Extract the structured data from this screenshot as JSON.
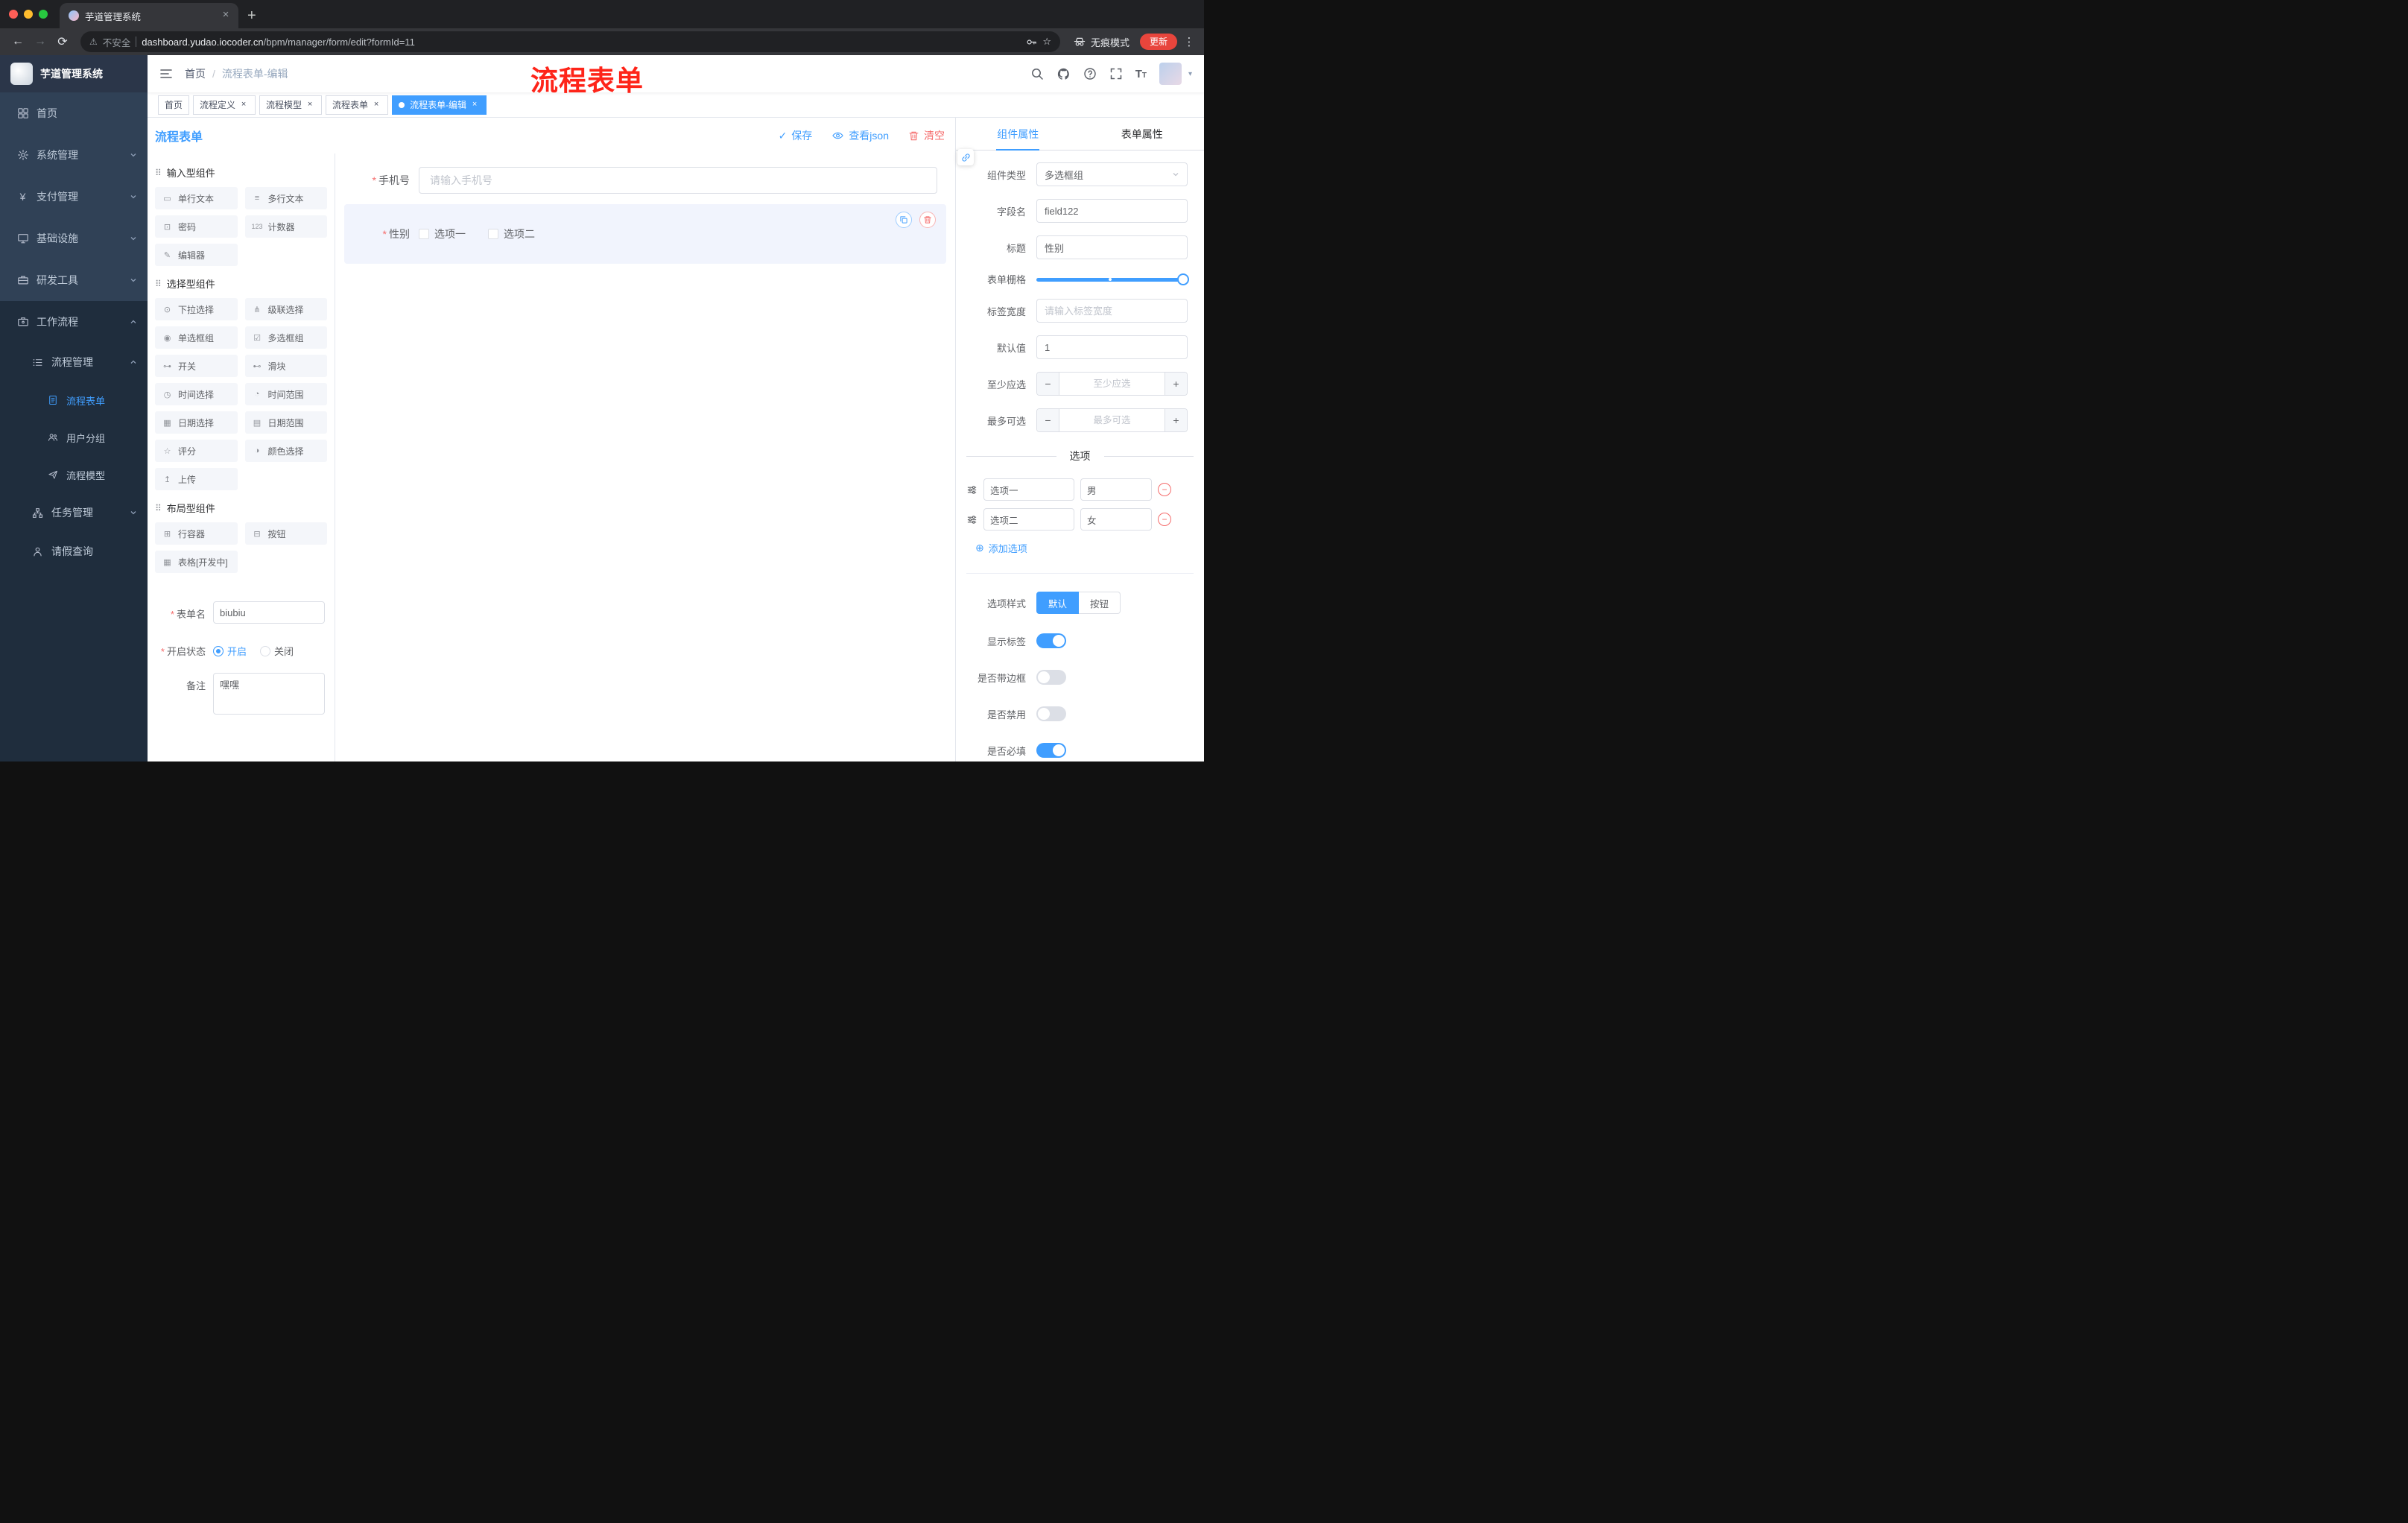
{
  "annotation": {
    "text": "流程表单"
  },
  "colors": {
    "accent": "#409eff",
    "danger": "#f56c6c",
    "annotation_red": "#fe2419",
    "active_tag": "#409eff"
  },
  "browser": {
    "tab_title": "芋道管理系统",
    "security_label": "不安全",
    "url_host": "dashboard.yudao.iocoder.cn",
    "url_path": "/bpm/manager/form/edit?formId=11",
    "incognito_label": "无痕模式",
    "update_label": "更新"
  },
  "sidebar": {
    "logo_title": "芋道管理系统",
    "items": [
      {
        "label": "首页"
      },
      {
        "label": "系统管理"
      },
      {
        "label": "支付管理"
      },
      {
        "label": "基础设施"
      },
      {
        "label": "研发工具"
      },
      {
        "label": "工作流程"
      },
      {
        "label": "流程管理"
      },
      {
        "label": "流程表单"
      },
      {
        "label": "用户分组"
      },
      {
        "label": "流程模型"
      },
      {
        "label": "任务管理"
      },
      {
        "label": "请假查询"
      }
    ]
  },
  "header": {
    "breadcrumb_home": "首页",
    "breadcrumb_current": "流程表单-编辑"
  },
  "tags": [
    {
      "label": "首页"
    },
    {
      "label": "流程定义"
    },
    {
      "label": "流程模型"
    },
    {
      "label": "流程表单"
    },
    {
      "label": "流程表单-编辑"
    }
  ],
  "designer": {
    "title": "流程表单",
    "save": "保存",
    "view_json": "查看json",
    "clear": "清空"
  },
  "palette": {
    "groups": [
      {
        "title": "输入型组件",
        "items": [
          {
            "label": "单行文本",
            "icon": "▭"
          },
          {
            "label": "多行文本",
            "icon": "≡"
          },
          {
            "label": "密码",
            "icon": "⊡"
          },
          {
            "label": "计数器",
            "icon": "123"
          },
          {
            "label": "编辑器",
            "icon": "✎"
          }
        ]
      },
      {
        "title": "选择型组件",
        "items": [
          {
            "label": "下拉选择",
            "icon": "⊙"
          },
          {
            "label": "级联选择",
            "icon": "⋔"
          },
          {
            "label": "单选框组",
            "icon": "◉"
          },
          {
            "label": "多选框组",
            "icon": "☑"
          },
          {
            "label": "开关",
            "icon": "⊶"
          },
          {
            "label": "滑块",
            "icon": "⊷"
          },
          {
            "label": "时间选择",
            "icon": "◷"
          },
          {
            "label": "时间范围",
            "icon": "◔"
          },
          {
            "label": "日期选择",
            "icon": "▦"
          },
          {
            "label": "日期范围",
            "icon": "▤"
          },
          {
            "label": "评分",
            "icon": "☆"
          },
          {
            "label": "颜色选择",
            "icon": "◑"
          },
          {
            "label": "上传",
            "icon": "↥"
          }
        ]
      },
      {
        "title": "布局型组件",
        "items": [
          {
            "label": "行容器",
            "icon": "⊞"
          },
          {
            "label": "按钮",
            "icon": "⊟"
          },
          {
            "label": "表格[开发中]",
            "icon": "▦"
          }
        ]
      }
    ],
    "form": {
      "name_label": "表单名",
      "name_value": "biubiu",
      "status_label": "开启状态",
      "status_on": "开启",
      "status_off": "关闭",
      "remark_label": "备注",
      "remark_value": "嘿嘿"
    }
  },
  "canvas": {
    "phone_label": "手机号",
    "phone_placeholder": "请输入手机号",
    "gender_label": "性别",
    "gender_opt1": "选项一",
    "gender_opt2": "选项二"
  },
  "props": {
    "tab_component": "组件属性",
    "tab_form": "表单属性",
    "component_type_label": "组件类型",
    "component_type_value": "多选框组",
    "field_label": "字段名",
    "field_value": "field122",
    "title_label": "标题",
    "title_value": "性别",
    "grid_label": "表单栅格",
    "label_width_label": "标签宽度",
    "label_width_placeholder": "请输入标签宽度",
    "default_label": "默认值",
    "default_value": "1",
    "min_label": "至少应选",
    "min_placeholder": "至少应选",
    "max_label": "最多可选",
    "max_placeholder": "最多可选",
    "options_divider": "选项",
    "options": [
      {
        "label": "选项一",
        "value": "男"
      },
      {
        "label": "选项二",
        "value": "女"
      }
    ],
    "add_option": "添加选项",
    "style_label": "选项样式",
    "style_default": "默认",
    "style_button": "按钮",
    "switch_show_label": "显示标签",
    "switch_border": "是否带边框",
    "switch_disabled": "是否禁用",
    "switch_required": "是否必填"
  }
}
